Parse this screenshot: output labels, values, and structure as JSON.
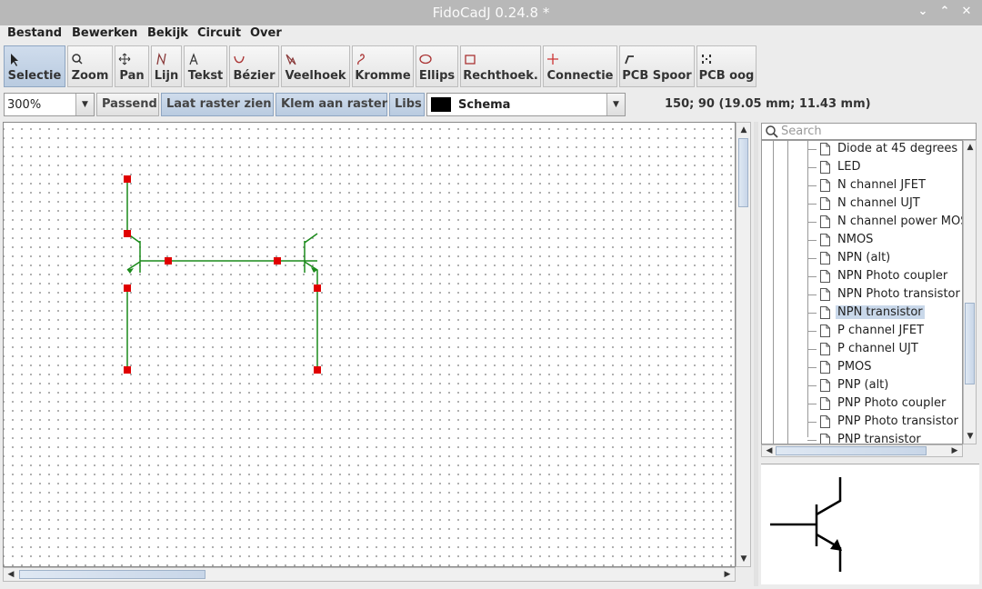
{
  "window": {
    "title": "FidoCadJ 0.24.8  *",
    "controls": [
      "⌄",
      "⌃",
      "✕"
    ]
  },
  "menu": [
    "Bestand",
    "Bewerken",
    "Bekijk",
    "Circuit",
    "Over"
  ],
  "toolbar": [
    {
      "label": "Selectie",
      "icon": "arrow-icon",
      "active": true
    },
    {
      "label": "Zoom",
      "icon": "magnifier-icon"
    },
    {
      "label": "Pan",
      "icon": "move-icon"
    },
    {
      "label": "Lijn",
      "icon": "line-icon"
    },
    {
      "label": "Tekst",
      "icon": "text-icon"
    },
    {
      "label": "Bézier",
      "icon": "bezier-icon"
    },
    {
      "label": "Veelhoek",
      "icon": "polygon-icon"
    },
    {
      "label": "Kromme",
      "icon": "curve-icon"
    },
    {
      "label": "Ellips",
      "icon": "ellipse-icon"
    },
    {
      "label": "Rechthoek.",
      "icon": "rectangle-icon"
    },
    {
      "label": "Connectie",
      "icon": "connection-icon"
    },
    {
      "label": "PCB Spoor",
      "icon": "pcb-track-icon"
    },
    {
      "label": "PCB oog",
      "icon": "pcb-pad-icon"
    }
  ],
  "options": {
    "zoom": "300%",
    "fit_label": "Passend",
    "grid_label": "Laat raster zien",
    "snap_label": "Klem aan raster",
    "libs_label": "Libs",
    "layer": "Schema",
    "layer_color": "#000000",
    "coordinates": "150; 90 (19.05 mm; 11.43 mm)"
  },
  "library": {
    "search_placeholder": "Search",
    "items": [
      "Diode at 45 degrees",
      "LED",
      "N channel JFET",
      "N channel UJT",
      "N channel power MOSFET",
      "NMOS",
      "NPN (alt)",
      "NPN Photo coupler",
      "NPN Photo transistor",
      "NPN transistor",
      "P channel JFET",
      "P channel UJT",
      "PMOS",
      "PNP (alt)",
      "PNP Photo coupler",
      "PNP Photo transistor",
      "PNP transistor"
    ],
    "selected": "NPN transistor"
  },
  "colors": {
    "wire": "#1a8a1a",
    "handle": "#e00000",
    "selection": "#c9d8ea"
  }
}
